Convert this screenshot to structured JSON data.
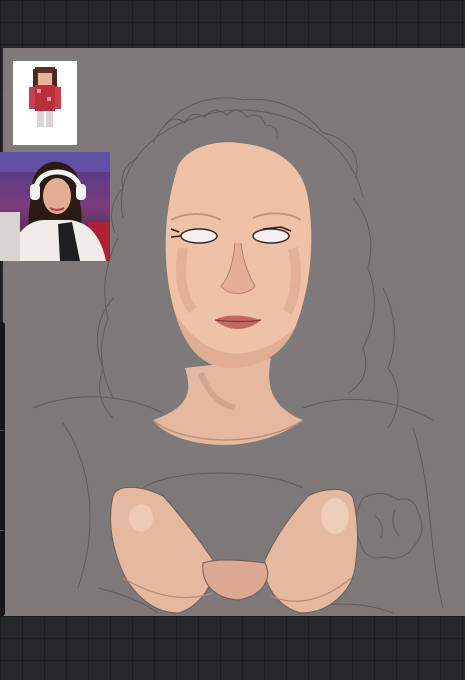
{
  "app": {
    "background_color": "#262729",
    "canvas_color": "#7e7a79"
  },
  "icons": {
    "left_handle": "sidebar-handle-icon"
  }
}
